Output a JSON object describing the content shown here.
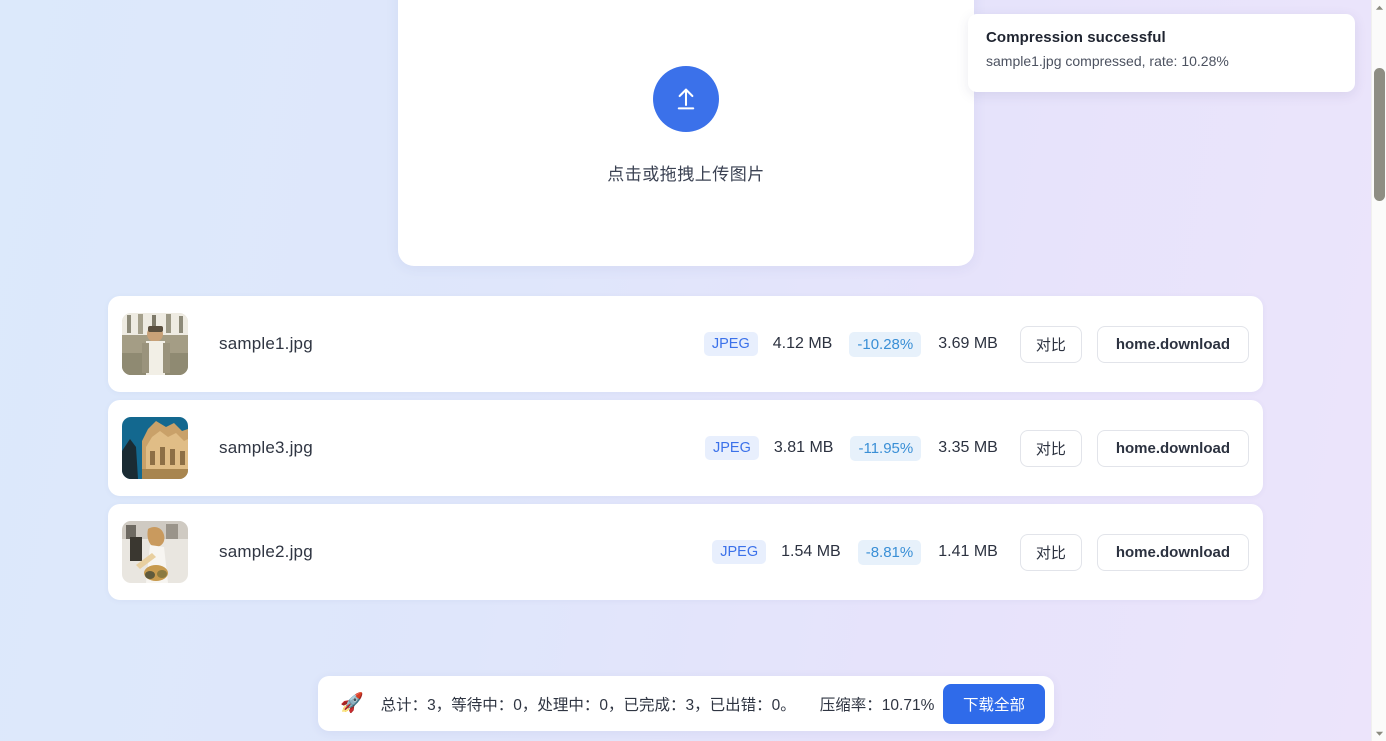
{
  "upload": {
    "icon": "upload-arrow-icon",
    "hint": "点击或拖拽上传图片"
  },
  "toast": {
    "title": "Compression successful",
    "message": "sample1.jpg compressed, rate: 10.28%"
  },
  "files": [
    {
      "name": "sample1.jpg",
      "format": "JPEG",
      "original_size": "4.12 MB",
      "rate": "-10.28%",
      "compressed_size": "3.69 MB",
      "compare_label": "对比",
      "download_label": "home.download"
    },
    {
      "name": "sample3.jpg",
      "format": "JPEG",
      "original_size": "3.81 MB",
      "rate": "-11.95%",
      "compressed_size": "3.35 MB",
      "compare_label": "对比",
      "download_label": "home.download"
    },
    {
      "name": "sample2.jpg",
      "format": "JPEG",
      "original_size": "1.54 MB",
      "rate": "-8.81%",
      "compressed_size": "1.41 MB",
      "compare_label": "对比",
      "download_label": "home.download"
    }
  ],
  "status": {
    "icon": "rocket-icon",
    "counts": "总计：3，等待中：0，处理中：0，已完成：3，已出错：0。",
    "rate": "压缩率：10.71%",
    "download_all_label": "下载全部"
  },
  "colors": {
    "accent": "#3b71ea",
    "badge_format_text": "#3b71ea",
    "badge_format_bg": "#e8effd",
    "badge_rate_text": "#3a8fd6",
    "badge_rate_bg": "#e7f1fb",
    "primary_button": "#2f6bea",
    "bg_start": "#dce9fb",
    "bg_end": "#ece4fb"
  }
}
